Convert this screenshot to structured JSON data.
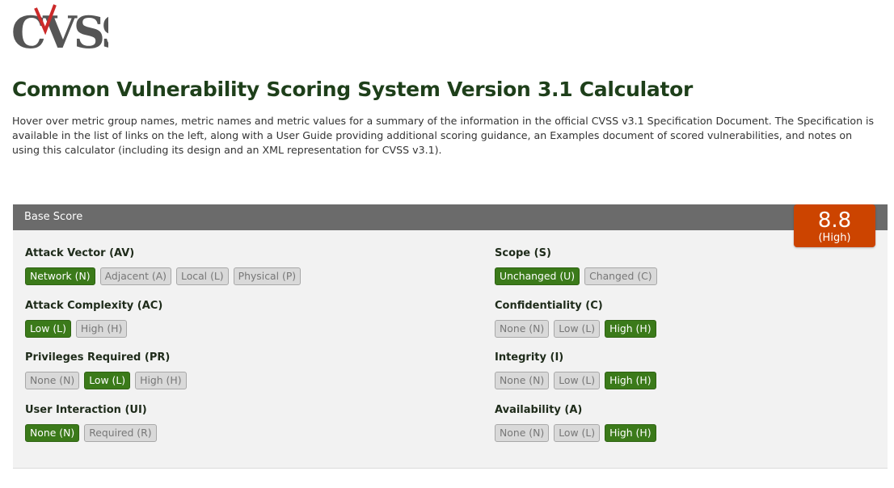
{
  "logo": {
    "text": "CVSS",
    "accent_color": "#cc2a2a",
    "text_color": "#555555"
  },
  "page_title": "Common Vulnerability Scoring System Version 3.1 Calculator",
  "intro": "Hover over metric group names, metric names and metric values for a summary of the information in the official CVSS v3.1 Specification Document. The Specification is available in the list of links on the left, along with a User Guide providing additional scoring guidance, an Examples document of scored vulnerabilities, and notes on using this calculator (including its design and an XML representation for CVSS v3.1).",
  "base_score": {
    "header": "Base Score",
    "score": "8.8",
    "severity": "(High)",
    "score_color": "#cc4400"
  },
  "metrics": {
    "av": {
      "name": "Attack Vector (AV)",
      "options": [
        "Network (N)",
        "Adjacent (A)",
        "Local (L)",
        "Physical (P)"
      ],
      "selected": 0
    },
    "ac": {
      "name": "Attack Complexity (AC)",
      "options": [
        "Low (L)",
        "High (H)"
      ],
      "selected": 0
    },
    "pr": {
      "name": "Privileges Required (PR)",
      "options": [
        "None (N)",
        "Low (L)",
        "High (H)"
      ],
      "selected": 1
    },
    "ui": {
      "name": "User Interaction (UI)",
      "options": [
        "None (N)",
        "Required (R)"
      ],
      "selected": 0
    },
    "s": {
      "name": "Scope (S)",
      "options": [
        "Unchanged (U)",
        "Changed (C)"
      ],
      "selected": 0
    },
    "c": {
      "name": "Confidentiality (C)",
      "options": [
        "None (N)",
        "Low (L)",
        "High (H)"
      ],
      "selected": 2
    },
    "i": {
      "name": "Integrity (I)",
      "options": [
        "None (N)",
        "Low (L)",
        "High (H)"
      ],
      "selected": 2
    },
    "a": {
      "name": "Availability (A)",
      "options": [
        "None (N)",
        "Low (L)",
        "High (H)"
      ],
      "selected": 2
    }
  },
  "colors": {
    "selected_option": "#3b7a1a",
    "title": "#1e3f1a",
    "header_bar": "#6b6b6b"
  }
}
